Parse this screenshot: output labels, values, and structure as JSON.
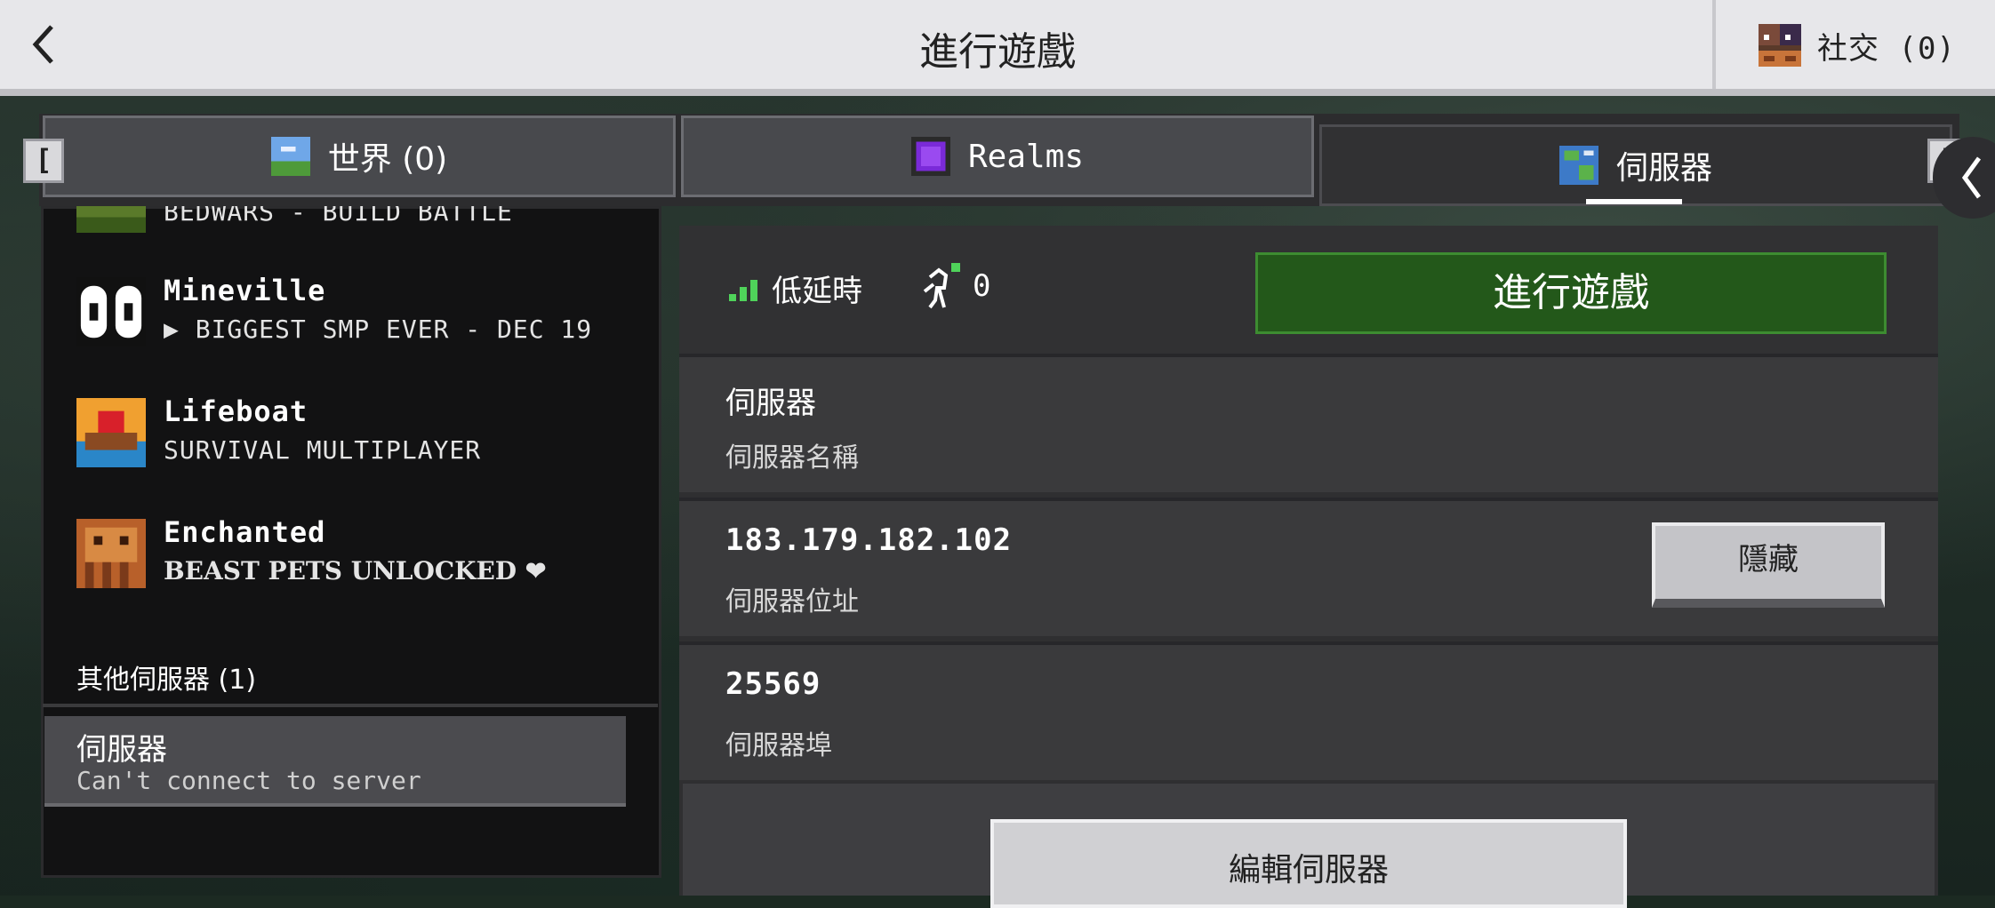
{
  "header": {
    "title": "進行遊戲",
    "back_icon": "chevron-left-icon",
    "social_label": "社交 (0)"
  },
  "tabs": [
    {
      "label": "世界 (0)",
      "icon": "world-icon"
    },
    {
      "label": "Realms",
      "icon": "realms-icon"
    },
    {
      "label": "伺服器",
      "icon": "globe-icon",
      "selected": true
    }
  ],
  "bracket_left": "[",
  "bracket_right": "]",
  "featured_servers": [
    {
      "name": "",
      "subtitle": "BEDWARS - BUILD BATTLE"
    },
    {
      "name": "Mineville",
      "subtitle": "▶ BIGGEST SMP EVER - DEC 19"
    },
    {
      "name": "Lifeboat",
      "subtitle": "SURVIVAL MULTIPLAYER"
    },
    {
      "name": "Enchanted",
      "subtitle": "BEAST PETS UNLOCKED ❤"
    }
  ],
  "other_servers": {
    "label": "其他伺服器 (1)",
    "items": [
      {
        "name": "伺服器",
        "status": "Can't connect to server"
      }
    ]
  },
  "detail": {
    "latency": "低延時",
    "players": "0",
    "play_button": "進行遊戲",
    "server_name_value": "伺服器",
    "server_name_label": "伺服器名稱",
    "address_value": "183.179.182.102",
    "address_label": "伺服器位址",
    "hide_button": "隱藏",
    "port_value": "25569",
    "port_label": "伺服器埠",
    "edit_button": "編輯伺服器"
  },
  "colors": {
    "play_green": "#23581a",
    "latency_green": "#4fd35a",
    "topbar": "#e7e7ea"
  }
}
